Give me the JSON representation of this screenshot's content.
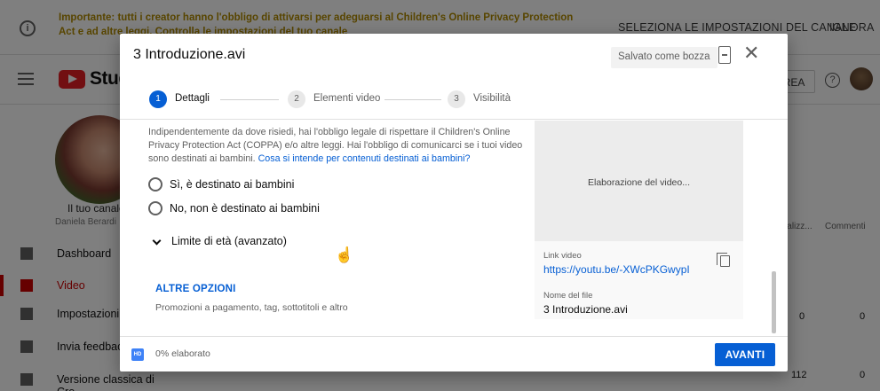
{
  "banner": {
    "text": "Importante: tutti i creator hanno l'obbligo di attivarsi per adeguarsi al Children's Online Privacy Protection Act e ad altre leggi. Controlla le impostazioni del tuo canale",
    "select_settings": "SELEZIONA LE IMPOSTAZIONI DEL CANALE",
    "ignore": "IGNORA",
    "accent": "#b18b00"
  },
  "header": {
    "logo_text": "Studio",
    "create": "CREA"
  },
  "sidebar": {
    "channel_label": "Il tuo canale",
    "owner": "Daniela Berardi",
    "items": [
      {
        "label": "Dashboard",
        "icon": "dashboard-icon"
      },
      {
        "label": "Video",
        "icon": "video-icon"
      },
      {
        "label": "Impostazioni",
        "icon": "gear-icon"
      },
      {
        "label": "Invia feedback",
        "icon": "feedback-icon"
      },
      {
        "label": "Versione classica di Cre...",
        "icon": "classic-icon"
      }
    ]
  },
  "background_table": {
    "col_views": "Visualizz...",
    "col_comments": "Commenti",
    "row1_views": "0",
    "row1_comments": "0",
    "row2_views": "112",
    "row2_comments": "0"
  },
  "dialog": {
    "title": "3 Introduzione.avi",
    "draft_status": "Salvato come bozza",
    "steps": [
      {
        "num": "1",
        "label": "Dettagli"
      },
      {
        "num": "2",
        "label": "Elementi video"
      },
      {
        "num": "3",
        "label": "Visibilità"
      }
    ],
    "coppa_text": "Indipendentemente da dove risiedi, hai l'obbligo legale di rispettare il Children's Online Privacy Protection Act (COPPA) e/o altre leggi. Hai l'obbligo di comunicarci se i tuoi video sono destinati ai bambini.",
    "coppa_link": "Cosa si intende per contenuti destinati ai bambini?",
    "radio_yes": "Sì, è destinato ai bambini",
    "radio_no": "No, non è destinato ai bambini",
    "age_restriction": "Limite di età (avanzato)",
    "more_options": "ALTRE OPZIONI",
    "more_options_desc": "Promozioni a pagamento, tag, sottotitoli e altro",
    "processing_text": "Elaborazione del video...",
    "video_link_label": "Link video",
    "video_link": "https://youtu.be/-XWcPKGwypI",
    "file_name_label": "Nome del file",
    "file_name": "3 Introduzione.avi",
    "processed_status": "0% elaborato",
    "next_button": "AVANTI",
    "primary_color": "#065fd4"
  }
}
